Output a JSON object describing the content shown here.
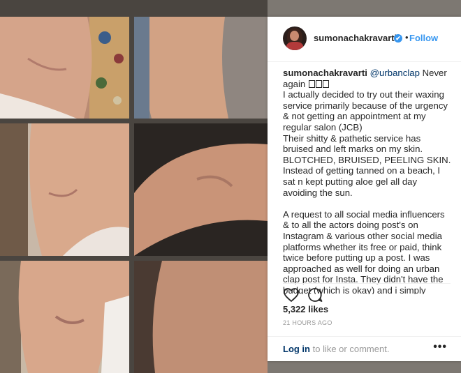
{
  "post": {
    "username": "sumonachakravarti",
    "follow_label": "Follow",
    "dot": "•",
    "verified_icon": "✔",
    "caption": {
      "author": "sumonachakravarti",
      "mention": "@urbanclap",
      "line1_rest": " Never again",
      "para1": "I actually decided to try out their waxing service primarily because of the urgency & not getting an appointment at my regular salon (JCB)",
      "para2": "Their shitty & pathetic service has bruised and left marks on my skin. BLOTCHED, BRUISED, PEELING SKIN.",
      "para3": "Instead of getting tanned on a beach, I sat n kept putting aloe gel all day avoiding the sun.",
      "para4": "A request to all social media influencers & to all the actors doing post's on Instagram & various other social media platforms whether its free or paid, think twice before putting up a post. I was approached as well for doing an urban clap post for Insta. They didn't have the budget (which is okay) and i simply decided to try out their waxing service and this is the outcome."
    },
    "likes": "5,322 likes",
    "timestamp": "21 HOURS AGO",
    "login_link": "Log in",
    "login_rest": " to like or comment.",
    "more_label": "•••"
  },
  "icons": {
    "heart": "heart-icon",
    "comment": "comment-icon",
    "more": "more-options-icon",
    "verified": "verified-badge-icon"
  },
  "colors": {
    "link_blue": "#3897f0",
    "mention": "#003569",
    "text": "#262626",
    "muted": "#999999"
  }
}
